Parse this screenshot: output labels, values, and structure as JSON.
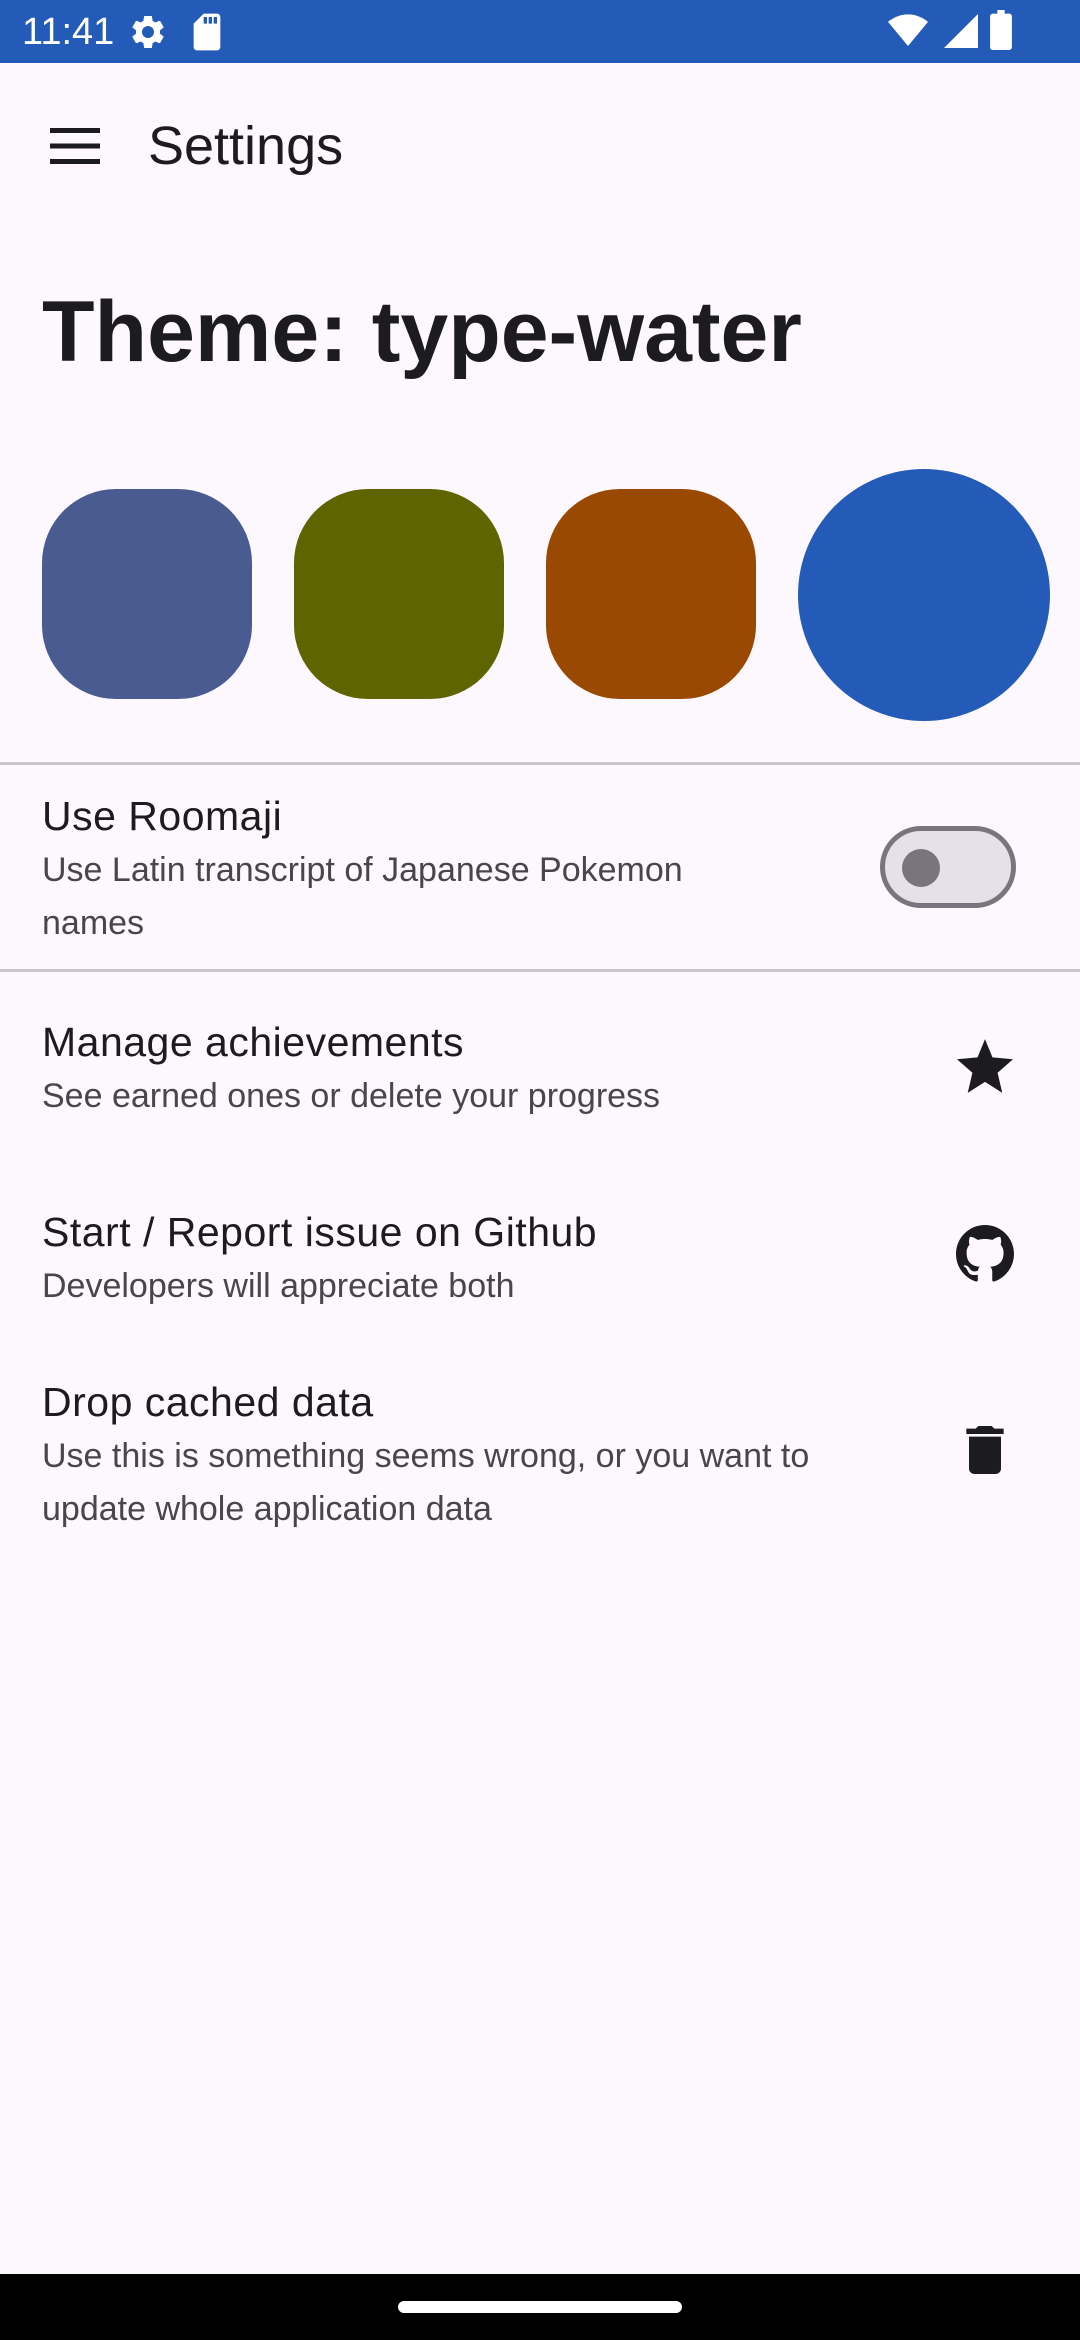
{
  "status_bar": {
    "time": "11:41",
    "icons": [
      "settings-gear-icon",
      "sd-card-icon",
      "wifi-icon",
      "cellular-signal-icon",
      "battery-icon"
    ]
  },
  "top_bar": {
    "title": "Settings",
    "menu_icon": "hamburger-menu-icon"
  },
  "theme": {
    "title": "Theme: type-water",
    "swatches": [
      {
        "name": "indigo",
        "color": "#4a5b91",
        "selected": false
      },
      {
        "name": "olive",
        "color": "#5e6400",
        "selected": false
      },
      {
        "name": "rust",
        "color": "#994901",
        "selected": false
      },
      {
        "name": "blue",
        "color": "#245bb8",
        "selected": true
      }
    ]
  },
  "settings": {
    "roomaji": {
      "title": "Use Roomaji",
      "description": "Use Latin transcript of Japanese Pokemon",
      "description_line2": "names",
      "enabled": false
    },
    "achievements": {
      "title": "Manage achievements",
      "description": "See earned ones or delete your progress",
      "icon": "star-icon"
    },
    "github": {
      "title": "Start / Report issue on Github",
      "description": "Developers will appreciate both",
      "icon": "github-icon"
    },
    "cache": {
      "title": "Drop cached data",
      "description": "Use this is something seems wrong, or you want to",
      "description_line2": "update whole application data",
      "icon": "trash-icon"
    }
  },
  "colors": {
    "status_bar": "#245bb8",
    "background": "#fdf8fd",
    "text_primary": "#1c1b1f",
    "text_secondary": "#48464c",
    "divider": "#c9c5ca"
  }
}
